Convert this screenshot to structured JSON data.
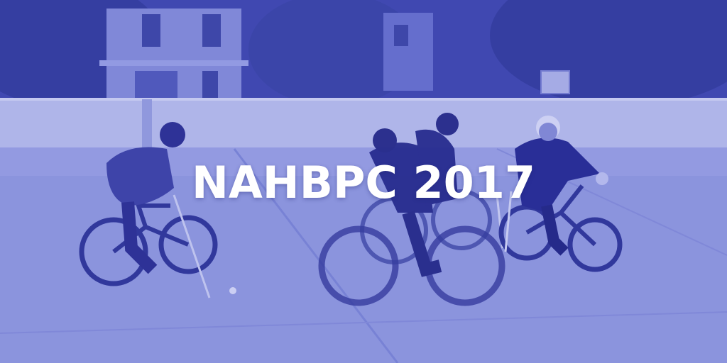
{
  "headline": "NAHBPC 2017",
  "palette": {
    "tint": "#5a62c8",
    "sky_dark": "#3a42a8",
    "wall": "#c8ccf0",
    "court": "#9aa2e2",
    "figure": "#2a3090",
    "text": "#ffffff"
  }
}
